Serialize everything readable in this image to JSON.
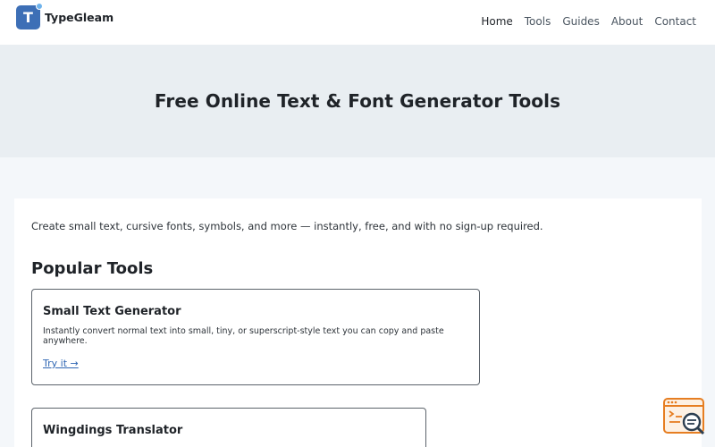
{
  "brand": {
    "name": "TypeGleam",
    "logo_letter": "T",
    "color": "#3d6fb6"
  },
  "nav": {
    "items": [
      {
        "label": "Home",
        "active": true
      },
      {
        "label": "Tools",
        "active": false
      },
      {
        "label": "Guides",
        "active": false
      },
      {
        "label": "About",
        "active": false
      },
      {
        "label": "Contact",
        "active": false
      }
    ]
  },
  "hero": {
    "title": "Free Online Text & Font Generator Tools"
  },
  "main": {
    "intro": "Create small text, cursive fonts, symbols, and more — instantly, free, and with no sign-up required.",
    "section_title": "Popular Tools",
    "tools": [
      {
        "title": "Small Text Generator",
        "description": "Instantly convert normal text into small, tiny, or superscript-style text you can copy and paste anywhere.",
        "link": "Try it →"
      },
      {
        "title": "Wingdings Translator"
      }
    ]
  },
  "widget": {
    "icon": "code-search-icon",
    "accent": "#e67e22"
  },
  "colors": {
    "link": "#2f66b3",
    "hero_bg": "#e9eef2",
    "page_bg": "#f4f7fa"
  }
}
